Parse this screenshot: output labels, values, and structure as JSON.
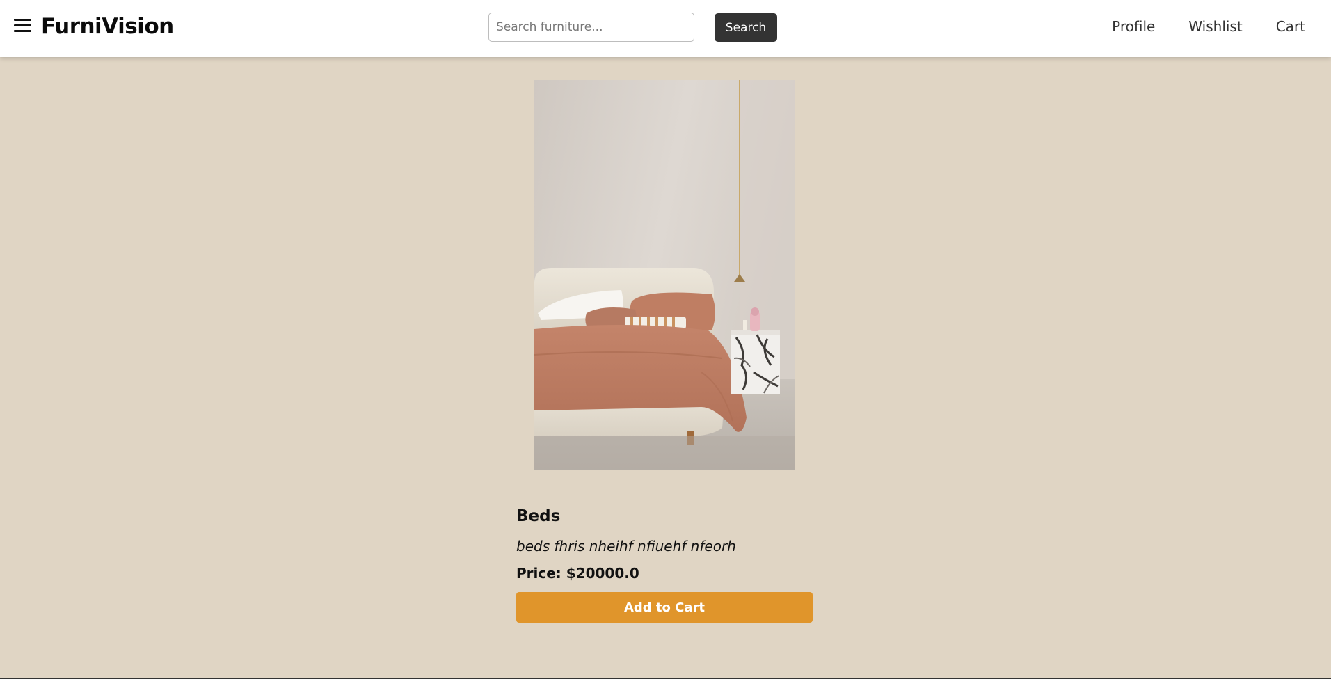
{
  "header": {
    "brand": "FurniVision",
    "menu_icon": "hamburger-menu-icon",
    "search": {
      "placeholder": "Search furniture...",
      "value": "",
      "button_label": "Search"
    },
    "nav": [
      "Profile",
      "Wishlist",
      "Cart"
    ]
  },
  "product": {
    "image_icon": "bed-photo",
    "name": "Beds",
    "description": "beds fhris nheihf nfiuehf nfeorh",
    "price": "Price: $20000.0",
    "add_to_cart_label": "Add to Cart"
  },
  "colors": {
    "background": "#e0d5c4",
    "header": "#ffffff",
    "search_button": "#333333",
    "accent": "#e0952b"
  }
}
